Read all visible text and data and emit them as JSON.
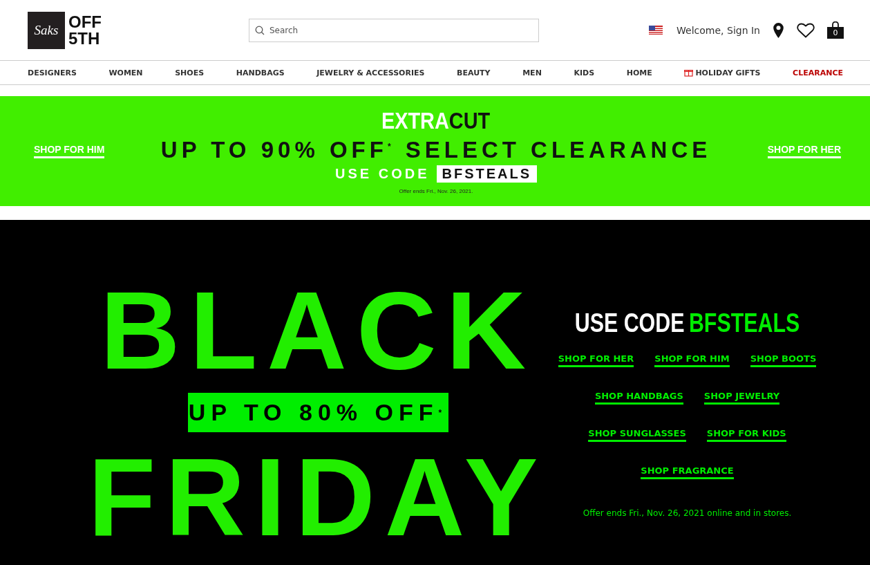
{
  "header": {
    "logo": {
      "script": "Saks",
      "line_1": "OFF",
      "line_2": "5TH"
    },
    "search": {
      "placeholder": "Search"
    },
    "account_link": "Welcome, Sign In",
    "cart_count": "0"
  },
  "nav": [
    {
      "label": "DESIGNERS",
      "kind": "plain"
    },
    {
      "label": "WOMEN",
      "kind": "plain"
    },
    {
      "label": "SHOES",
      "kind": "plain"
    },
    {
      "label": "HANDBAGS",
      "kind": "plain"
    },
    {
      "label": "JEWELRY & ACCESSORIES",
      "kind": "plain"
    },
    {
      "label": "BEAUTY",
      "kind": "plain"
    },
    {
      "label": "MEN",
      "kind": "plain"
    },
    {
      "label": "KIDS",
      "kind": "plain"
    },
    {
      "label": "HOME",
      "kind": "plain"
    },
    {
      "label": "HOLIDAY GIFTS",
      "kind": "gift"
    },
    {
      "label": "CLEARANCE",
      "kind": "sale"
    }
  ],
  "promo_banner": {
    "left_link": "SHOP FOR HIM",
    "right_link": "SHOP FOR HER",
    "headline_extra": "EXTRA",
    "headline_cut": "CUT",
    "offer": "UP TO 90% OFF$^{*}$ SELECT CLEARANCE",
    "code_label": "USE CODE",
    "code": "BFSTEALS",
    "fine_print": "Offer ends Fri., Nov. 26, 2021."
  },
  "hero": {
    "title_line_1": "BLACK",
    "offer": "UP TO 80% OFF$^{*}$",
    "title_line_2": "FRIDAY",
    "code_label": "USE CODE",
    "code": "BFSTEALS",
    "link_rows": [
      [
        "SHOP FOR HER",
        "SHOP FOR HIM",
        "SHOP BOOTS"
      ],
      [
        "SHOP HANDBAGS",
        "SHOP JEWELRY"
      ],
      [
        "SHOP SUNGLASSES",
        "SHOP FOR KIDS"
      ],
      [
        "SHOP FRAGRANCE"
      ]
    ],
    "fine_print": "Offer ends Fri., Nov. 26, 2021 online and in stores."
  }
}
